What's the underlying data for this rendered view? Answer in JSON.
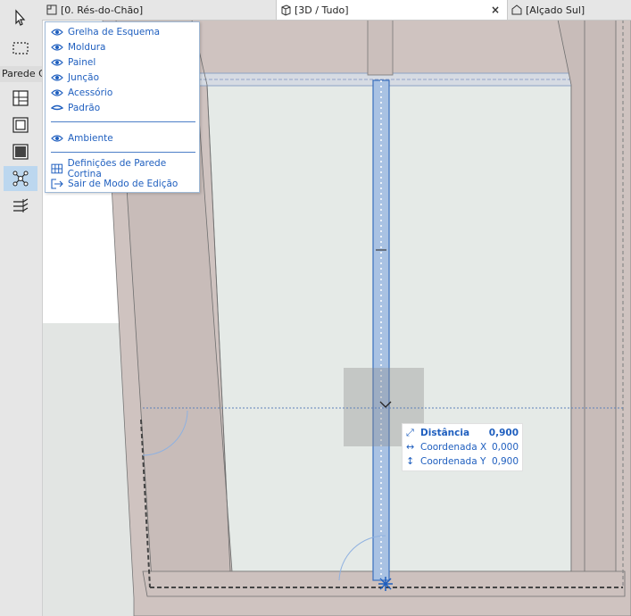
{
  "toolbox": {
    "label": "Parede Cortina"
  },
  "tabs": [
    {
      "label": "[0. Rés-do-Chão]",
      "icon": "floor-plan-icon"
    },
    {
      "label": "[3D / Tudo]",
      "icon": "cube-3d-icon",
      "close": "×"
    },
    {
      "label": "[Alçado Sul]",
      "icon": "elevation-icon"
    }
  ],
  "menu": {
    "items": [
      {
        "label": "Grelha de Esquema",
        "icon": "eye-icon"
      },
      {
        "label": "Moldura",
        "icon": "eye-icon"
      },
      {
        "label": "Painel",
        "icon": "eye-icon"
      },
      {
        "label": "Junção",
        "icon": "eye-icon"
      },
      {
        "label": "Acessório",
        "icon": "eye-icon"
      },
      {
        "label": "Padrão",
        "icon": "eye-closed-icon"
      }
    ],
    "ambient": {
      "label": "Ambiente",
      "icon": "eye-icon"
    },
    "settings": {
      "label": "Definições de Parede Cortina",
      "icon": "curtain-wall-settings-icon"
    },
    "exit": {
      "label": "Sair de Modo de Edição",
      "icon": "exit-icon"
    }
  },
  "tracker": {
    "distance_label": "Distância",
    "distance_value": "0,900",
    "x_label": "Coordenada X",
    "x_value": "0,000",
    "y_label": "Coordenada Y",
    "y_value": "0,900"
  },
  "colors": {
    "accent": "#1f5fbf",
    "frame": "#c9bebb",
    "glass": "#e4e9e6",
    "highlight": "#bcd7ef"
  }
}
